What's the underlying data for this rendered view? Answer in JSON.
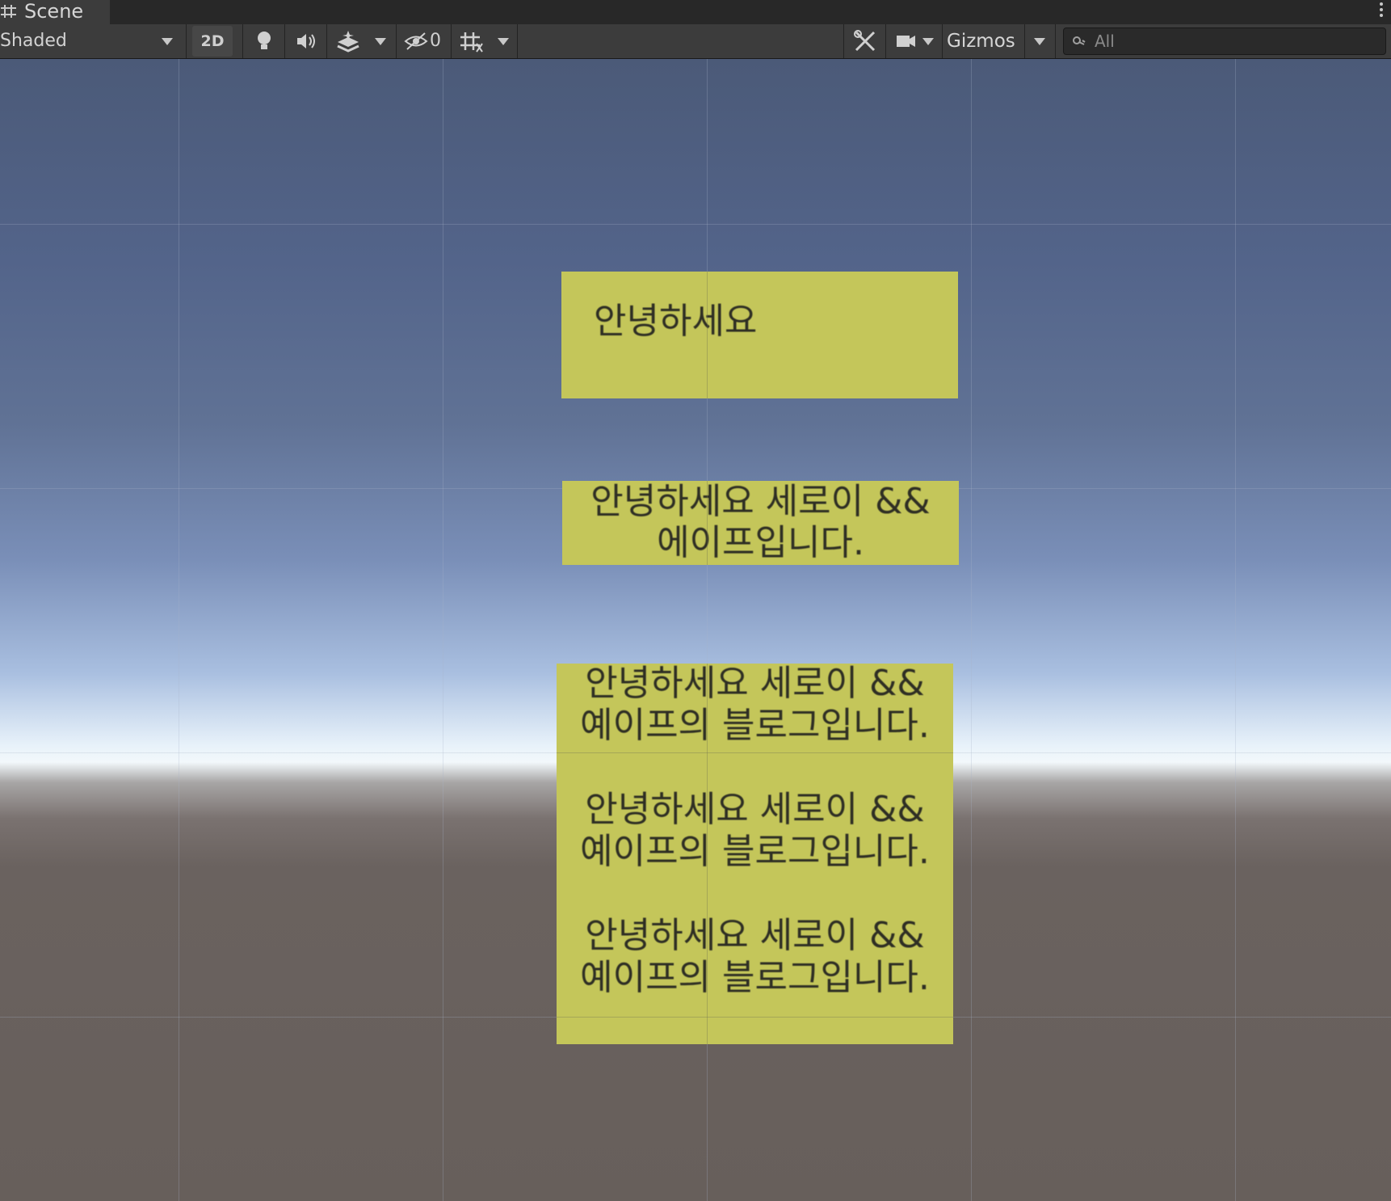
{
  "tab": {
    "title": "Scene",
    "icon": "scene-grid-icon"
  },
  "toolbar": {
    "draw_mode": "Shaded",
    "toggle_2d": "2D",
    "hidden_count": "0",
    "gizmos_label": "Gizmos",
    "search_placeholder": "All",
    "icons": [
      "lightbulb-icon",
      "audio-speaker-icon",
      "effects-layers-icon",
      "visibility-hidden-icon",
      "grid-snap-icon",
      "tools-icon",
      "camera-icon",
      "search-icon"
    ]
  },
  "scene": {
    "panels": [
      {
        "text": "안녕하세요"
      },
      {
        "text": "안녕하세요 세로이 &&\n에이프입니다."
      },
      {
        "text": "안녕하세요 세로이 &&\n예이프의 블로그입니다.\n\n안녕하세요 세로이 &&\n예이프의 블로그입니다.\n\n안녕하세요 세로이 &&\n예이프의 블로그입니다."
      }
    ],
    "panel_color": "#c4c65a",
    "sky_color": "#4b5a78",
    "ground_color": "#675f5b"
  }
}
